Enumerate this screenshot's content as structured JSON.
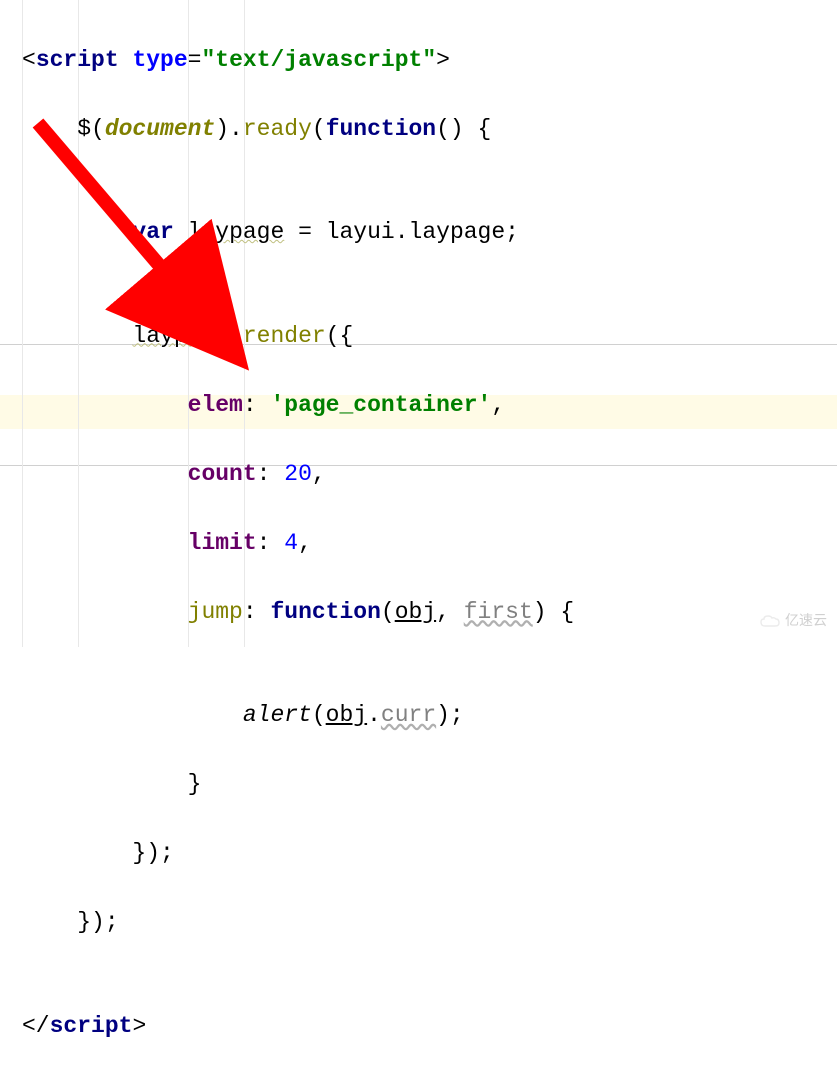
{
  "code": {
    "l1": {
      "open": "<",
      "tag": "script",
      "sp": " ",
      "attr": "type",
      "eq": "=",
      "q1": "\"",
      "val": "text/javascript",
      "q2": "\"",
      "close": ">"
    },
    "l2": {
      "indent": "    ",
      "dollar": "$(",
      "doc": "document",
      "p2": ").",
      "ready": "ready",
      "p3": "(",
      "fn": "function",
      "p4": "() {"
    },
    "l3": "",
    "l4": {
      "indent": "        ",
      "var": "var",
      "sp": " ",
      "laypage": "laypage",
      "sp2": " = ",
      "layui": "layui",
      "dot": ".",
      "laypage2": "laypage",
      "semi": ";"
    },
    "l5": "",
    "l6": {
      "indent": "        ",
      "laypage": "laypage",
      "dot": ".",
      "render": "render",
      "p": "({"
    },
    "l7": {
      "indent": "            ",
      "key": "elem",
      "colon": ": ",
      "val": "'page_container'",
      "comma": ","
    },
    "l8": {
      "indent": "            ",
      "key": "count",
      "colon": ": ",
      "val": "20",
      "comma": ","
    },
    "l9": {
      "indent": "            ",
      "key": "limit",
      "colon": ": ",
      "val": "4",
      "comma": ","
    },
    "l10": {
      "indent": "            ",
      "key": "jump",
      "colon": ": ",
      "fn": "function",
      "p1": "(",
      "obj": "obj",
      "comma": ", ",
      "first": "first",
      "p2": ") {"
    },
    "l11": "",
    "l12": {
      "indent": "                ",
      "alert": "alert",
      "p1": "(",
      "obj": "obj",
      "dot": ".",
      "curr": "curr",
      "p2": ");"
    },
    "l13": {
      "indent": "            ",
      "brace": "}"
    },
    "l14": {
      "indent": "        ",
      "close": "});"
    },
    "l15": {
      "indent": "    ",
      "close": "});"
    },
    "l16": "",
    "l17": {
      "open": "</",
      "tag": "script",
      "close": ">"
    }
  },
  "watermark": "亿速云"
}
